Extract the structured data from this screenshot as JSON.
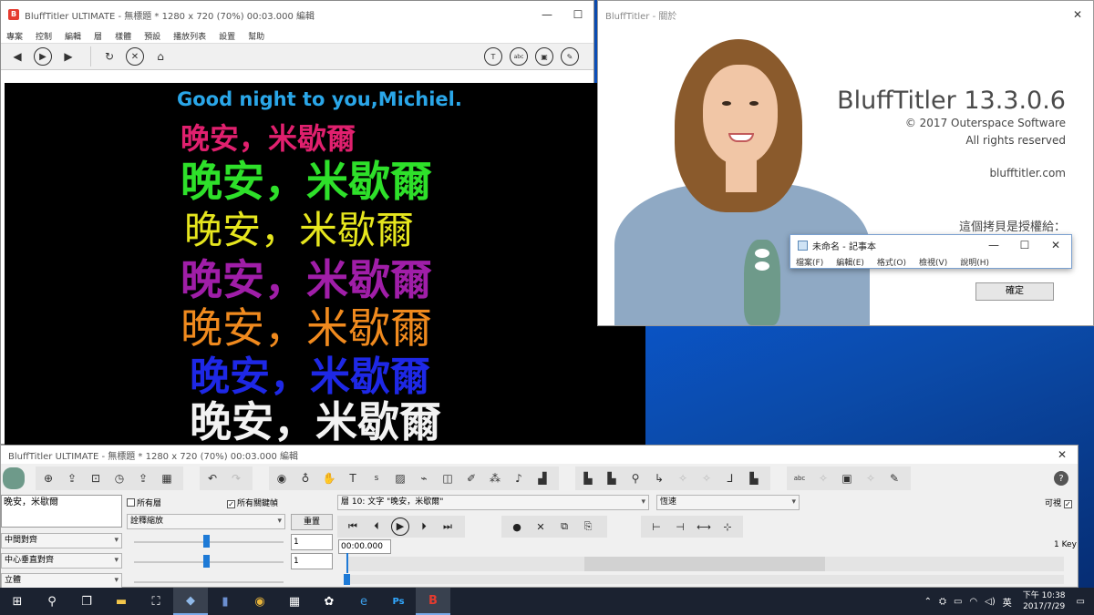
{
  "preview_window": {
    "title": "BluffTitler ULTIMATE - 無標題 * 1280 x 720 (70%) 00:03.000 編輯",
    "menu": [
      "專案",
      "控制",
      "編輯",
      "層",
      "樣體",
      "預設",
      "播放列表",
      "設置",
      "幫助"
    ],
    "canvas_lines": [
      {
        "text": "Good night to you,Michiel.",
        "color": "#2aa6e8"
      },
      {
        "text": "晚安，米歇爾",
        "color": "#e0206e"
      },
      {
        "text": "晚安，米歇爾",
        "color": "#2ee02a"
      },
      {
        "text": "晚安，米歇爾",
        "color": "#e6e61e"
      },
      {
        "text": "晚安，米歇爾",
        "color": "#a01ea8"
      },
      {
        "text": "晚安，米歇爾",
        "color": "#f08a1e"
      },
      {
        "text": "晚安，米歇爾",
        "color": "#1e28e6"
      },
      {
        "text": "晚安，米歇爾",
        "color": "#f2f2f2"
      }
    ]
  },
  "about_dialog": {
    "title": "BluffTitler - 關於",
    "product": "BluffTitler 13.3.0.6",
    "copyright": "© 2017 Outerspace Software",
    "rights": "All rights reserved",
    "website": "blufftitler.com",
    "licensed_to": "這個拷貝是授權給：",
    "ok_label": "確定"
  },
  "notepad": {
    "title": "未命名 - 記事本",
    "menu": [
      "檔案(F)",
      "編輯(E)",
      "格式(O)",
      "檢視(V)",
      "說明(H)"
    ]
  },
  "timeline_window": {
    "title": "BluffTitler ULTIMATE - 無標題 * 1280 x 720 (70%) 00:03.000 編輯",
    "text_box_value": "晚安，米歇爾",
    "all_layers_label": "所有層",
    "all_keys_label": "所有關鍵幀",
    "property_select": "詮釋縮放",
    "reset_label": "重置",
    "align_h": "中間對齊",
    "align_v": "中心垂直對齊",
    "style_select": "立體",
    "value_1": "1",
    "value_2": "1",
    "layer_select": "層 10: 文字 \"晚安，米歇爾\"",
    "speed_select": "恆速",
    "visible_label": "可視",
    "time_value": "00:00.000",
    "key_count": "1 Key"
  },
  "taskbar": {
    "time": "下午 10:38",
    "date": "2017/7/29",
    "ime": "英"
  },
  "colors": {
    "taskbar": "#1b2230",
    "accent": "#1e7ad6"
  }
}
